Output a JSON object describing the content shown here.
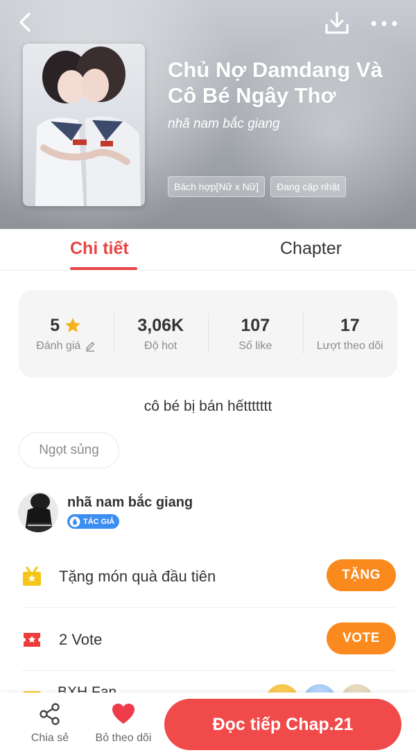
{
  "book": {
    "title": "Chủ Nợ Damdang Và Cô Bé Ngây Thơ",
    "author": "nhã nam bắc giang",
    "tags": [
      "Bách hợp[Nữ x Nữ]",
      "Đang cập nhật"
    ]
  },
  "tabs": [
    {
      "label": "Chi tiết",
      "active": true
    },
    {
      "label": "Chapter",
      "active": false
    }
  ],
  "stats": [
    {
      "value": "5",
      "label": "Đánh giá"
    },
    {
      "value": "3,06K",
      "label": "Độ hot"
    },
    {
      "value": "107",
      "label": "Số like"
    },
    {
      "value": "17",
      "label": "Lượt theo dõi"
    }
  ],
  "description": "cô bé bị bán hếttttttt",
  "genre": "Ngọt sủng",
  "author_section": {
    "name": "nhã nam bắc giang",
    "badge": "TÁC GIẢ"
  },
  "actions": {
    "gift_label": "Tặng món quà đầu tiên",
    "gift_button": "TẶNG",
    "vote_label": "2 Vote",
    "vote_button": "VOTE",
    "fan_label": "BXH Fan"
  },
  "bottom_bar": {
    "share_label": "Chia sẻ",
    "follow_label": "Bỏ theo dõi",
    "read_button": "Đọc tiếp Chap.21"
  },
  "colors": {
    "accent_red": "#e84545",
    "vote_orange": "#fa8a1e",
    "badge_blue": "#3b8ef0",
    "gift_yellow": "#f5c518"
  }
}
